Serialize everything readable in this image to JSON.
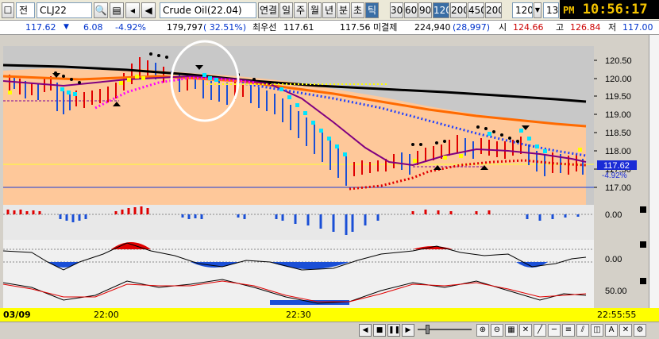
{
  "toolbar": {
    "exchange_label": "전",
    "symbol": "CLJ22",
    "search_icon": "🔍",
    "product_name": "Crude Oil(22.04)",
    "buttons": [
      "연결",
      "일",
      "주",
      "월",
      "년",
      "분",
      "초",
      "틱"
    ],
    "active_button": "틱",
    "intervals": [
      "30",
      "60",
      "90",
      "120",
      "200",
      "450",
      "200"
    ],
    "active_interval": "120",
    "interval_select": "120",
    "count_field": "13",
    "clock_ampm": "PM",
    "clock_time": "10:56:17"
  },
  "quote": {
    "last_price": "117.62",
    "change": "6.08",
    "change_pct": "-4.92%",
    "volume": "179,797",
    "volume_ratio": "( 32.51%)",
    "best_bid_label": "최우선",
    "best_bid": "117.61",
    "best_ask": "117.56",
    "unsettled_label": "미결제",
    "open_interest": "224,940",
    "oi_change": "(28,997)",
    "open_label": "시",
    "open": "124.66",
    "high_label": "고",
    "high": "126.84",
    "low_label": "저",
    "low": "117.00"
  },
  "price_axis": [
    "120.50",
    "120.00",
    "119.50",
    "119.00",
    "118.50",
    "118.00",
    "117.50",
    "117.00"
  ],
  "price_tag": "117.62",
  "price_tag_pct": "-4.92%",
  "indicator_axis": {
    "p1": "0.00",
    "p2": "0.00",
    "p3": "50.00"
  },
  "time_axis": {
    "date": "03/09",
    "t1": "22:00",
    "t2": "22:30",
    "now": "22:55:55"
  },
  "colors": {
    "bg_fill": "#fec89a",
    "sma_long": "#000000",
    "sma_mid": "#ff6a00",
    "up": "#e00000",
    "down": "#1a4fd6",
    "psar_cyan": "#00e5ff"
  }
}
